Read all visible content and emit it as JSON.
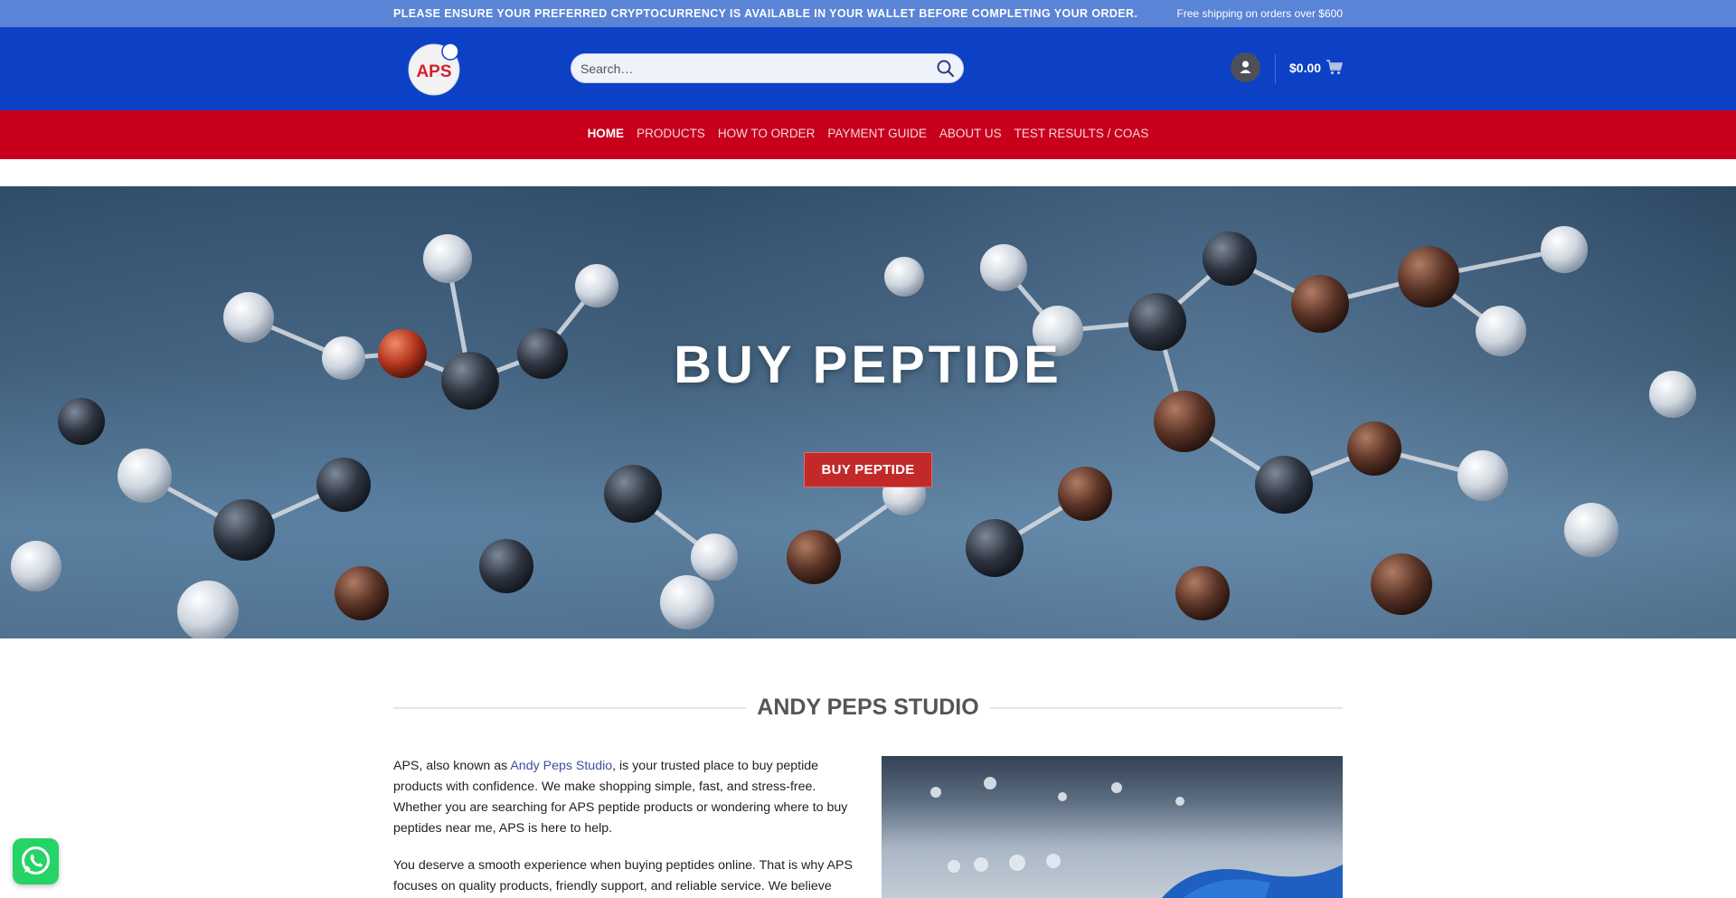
{
  "topbar": {
    "notice": "PLEASE ENSURE YOUR PREFERRED CRYPTOCURRENCY IS AVAILABLE IN YOUR WALLET BEFORE COMPLETING YOUR ORDER.",
    "shipping": "Free shipping on orders over $600"
  },
  "header": {
    "logo_text": "APS",
    "search_placeholder": "Search…",
    "cart_total": "$0.00"
  },
  "nav": {
    "items": [
      {
        "label": "HOME",
        "active": true
      },
      {
        "label": "PRODUCTS"
      },
      {
        "label": "HOW TO ORDER"
      },
      {
        "label": "PAYMENT GUIDE"
      },
      {
        "label": "ABOUT US"
      },
      {
        "label": "TEST RESULTS / COAS"
      }
    ]
  },
  "hero": {
    "title": "BUY PEPTIDE",
    "button": "BUY PEPTIDE"
  },
  "section": {
    "title": "ANDY PEPS STUDIO",
    "p1_before": "APS, also known as ",
    "p1_link": "Andy Peps Studio",
    "p1_after": ", is your trusted place to buy peptide products with confidence. We make shopping simple, fast, and stress-free. Whether you are searching for APS peptide products or wondering where to buy peptides near me, APS is here to help.",
    "p2": "You deserve a smooth experience when buying peptides online. That is why APS focuses on quality products, friendly support, and reliable service. We believe"
  },
  "colors": {
    "topbar": "#5a84d6",
    "header": "#0c41c6",
    "nav": "#c8001b",
    "button": "#c22a2a"
  },
  "icons": [
    "search-icon",
    "user-icon",
    "cart-icon",
    "whatsapp-icon"
  ]
}
